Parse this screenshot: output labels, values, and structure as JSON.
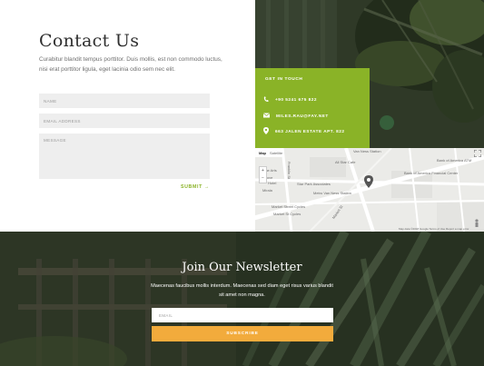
{
  "contact": {
    "title": "Contact Us",
    "intro": "Curabitur blandit tempus porttitor. Duis mollis, est non commodo luctus, nisi erat porttitor ligula, eget lacinia odio sem nec elit.",
    "name_placeholder": "NAME",
    "email_placeholder": "EMAIL ADDRESS",
    "message_placeholder": "MESSAGE",
    "submit_label": "SUBMIT",
    "submit_arrow": "→"
  },
  "info": {
    "heading": "GET IN TOUCH",
    "phone": "+90 5241 675 822",
    "email": "MILES.RAU@FAY.NET",
    "address": "663 JALEN ESTATE APT. 822",
    "accent_color": "#8ab327"
  },
  "map": {
    "tab_map": "Map",
    "tab_satellite": "Satellite",
    "zoom_in": "+",
    "zoom_out": "−",
    "labels": {
      "van_ness": "Van Ness Station",
      "all_star_cafe": "All Star Cafe",
      "bank_of_america_atm": "Bank of America ATM",
      "bank_of_america_fc": "Bank of America Financial Center",
      "star_park": "Star Park Associates",
      "muni_van_ness": "Metro Van Ness Station",
      "market_street_cycles": "Market Street Cycles",
      "franklin_st": "Franklin St",
      "market_st": "Market St",
      "fine_arts": "Fine Arts",
      "mirala": "Mirala",
      "cove": "Cove",
      "hotel": "Hotel",
      "market_street_cycles2": "Market St Cycles",
      "footer": "Map data ©2018 Google  Terms of Use  Report a map error"
    }
  },
  "newsletter": {
    "title": "Join Our Newsletter",
    "description": "Maecenas faucibus mollis interdum. Maecenas sed diam eget risus varius blandit sit amet non magna.",
    "email_placeholder": "EMAIL",
    "subscribe_label": "SUBSCRIBE",
    "button_color": "#f2ab3c"
  }
}
